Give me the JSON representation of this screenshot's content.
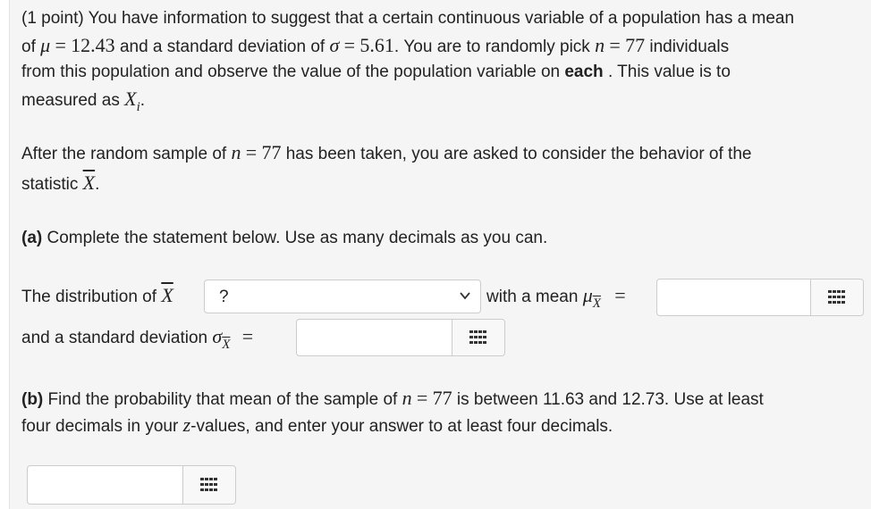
{
  "intro": {
    "line1": "(1 point) You have information to suggest that a certain continuous variable of a population has a mean",
    "of": "of",
    "mu_sym": "μ",
    "eq": "=",
    "mu_val": "12.43",
    "sd_text": "and a standard deviation of",
    "sigma_sym": "σ",
    "sigma_val": "5.61",
    "pick_text": ". You are to randomly pick",
    "n_sym": "n",
    "n_val": "77",
    "individuals": "individuals",
    "line3a": "from this population and observe the value of the population variable on",
    "each": "each",
    "line3b": ". This value is to",
    "line4": "measured as",
    "xi": "X",
    "i": "i",
    "period": "."
  },
  "after": {
    "a": "After the random sample of",
    "n": "n",
    "eq": "=",
    "nval": "77",
    "b": "has been taken, you are asked to consider the behavior of the",
    "statistic": "statistic",
    "xbar": "X",
    "period": "."
  },
  "part_a": {
    "label": "(a)",
    "text": "Complete the statement below. Use as many decimals as you can.",
    "dist_text": "The distribution of",
    "xbar": "X",
    "select_value": "?",
    "mean_text": "with a mean",
    "mu": "μ",
    "xsub": "X",
    "eq": "=",
    "sd_text": "and a standard deviation",
    "sigma": "σ",
    "mean_value": "",
    "sd_value": ""
  },
  "part_b": {
    "label": "(b)",
    "text1": "Find the probability that mean of the sample of",
    "n": "n",
    "eq": "=",
    "nval": "77",
    "text2": "is between 11.63 and 12.73. Use at least",
    "text3a": "four decimals in your",
    "z": "z",
    "text3b": "-values, and enter your answer to at least four decimals.",
    "answer_value": ""
  }
}
